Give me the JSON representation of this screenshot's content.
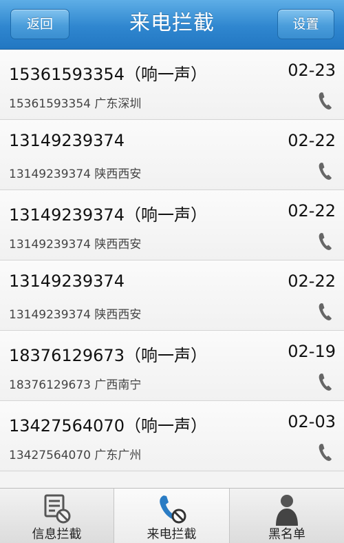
{
  "header": {
    "back_label": "返回",
    "title": "来电拦截",
    "settings_label": "设置"
  },
  "calls": [
    {
      "title": "15361593354（响一声）",
      "date": "02-23",
      "subtitle": "15361593354 广东深圳"
    },
    {
      "title": "13149239374",
      "date": "02-22",
      "subtitle": "13149239374 陕西西安"
    },
    {
      "title": "13149239374（响一声）",
      "date": "02-22",
      "subtitle": "13149239374 陕西西安"
    },
    {
      "title": "13149239374",
      "date": "02-22",
      "subtitle": "13149239374 陕西西安"
    },
    {
      "title": "18376129673（响一声）",
      "date": "02-19",
      "subtitle": "18376129673 广西南宁"
    },
    {
      "title": "13427564070（响一声）",
      "date": "02-03",
      "subtitle": "13427564070 广东广州"
    }
  ],
  "tabs": [
    {
      "label": "信息拦截",
      "icon": "message-block-icon"
    },
    {
      "label": "来电拦截",
      "icon": "call-block-icon"
    },
    {
      "label": "黑名单",
      "icon": "blacklist-person-icon"
    }
  ],
  "colors": {
    "header_blue": "#2f86cf",
    "tab_active_icon": "#2a7cc4",
    "phone_icon": "#666666"
  }
}
